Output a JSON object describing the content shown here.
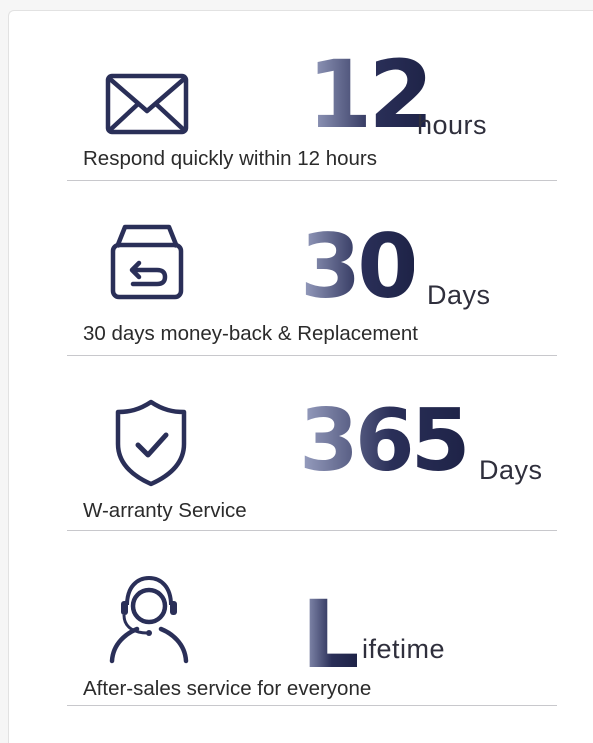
{
  "colors": {
    "icon_stroke": "#2a2f58",
    "number_gradient_start": "#9aa1c2",
    "number_gradient_end": "#1e2347",
    "divider": "#c8c8cc"
  },
  "items": [
    {
      "icon": "mail-envelope-icon",
      "number": "12",
      "unit": "hours",
      "caption": "Respond quickly within 12 hours"
    },
    {
      "icon": "return-box-icon",
      "number": "30",
      "unit": "Days",
      "caption": "30 days money-back & Replacement"
    },
    {
      "icon": "shield-check-icon",
      "number": "365",
      "unit": "Days",
      "caption": "W-arranty Service"
    },
    {
      "icon": "headset-agent-icon",
      "number": "L",
      "unit": "ifetime",
      "caption": "After-sales service for everyone"
    }
  ]
}
